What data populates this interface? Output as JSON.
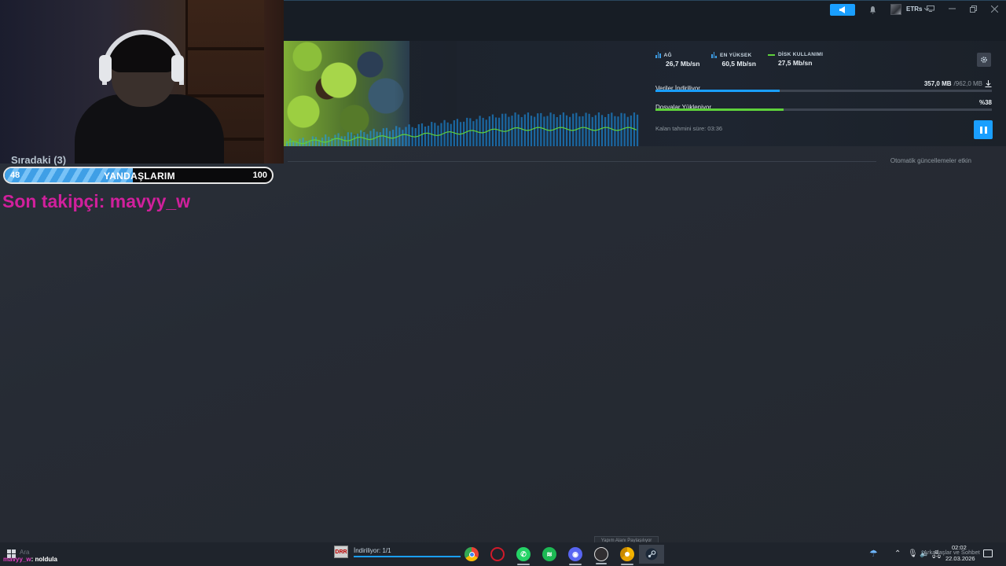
{
  "topbar": {
    "username": "ETRs",
    "icons": [
      "megaphone-icon",
      "bell-icon",
      "avatar",
      "chevron-down-icon",
      "monitor-icon",
      "minimize-icon",
      "maximize-icon",
      "close-icon"
    ],
    "accent_color": "#1a9fff"
  },
  "download": {
    "stats": [
      {
        "label": "AĞ",
        "value": "26,7 Mb/sn",
        "icon": "network-bars-icon"
      },
      {
        "label": "EN YÜKSEK",
        "value": "60,5 Mb/sn",
        "icon": "peak-bars-icon"
      },
      {
        "label": "DİSK KULLANIMI",
        "value": "27,5 Mb/sn",
        "icon": "disk-line-icon"
      }
    ],
    "download_label": "Veriler İndiriliyor",
    "download_done": "357,0 MB",
    "download_total": "/962,0 MB",
    "download_progress": 0.37,
    "disk_label": "Dosyalar Yükleniyor",
    "disk_percent": "%38",
    "disk_progress": 0.38,
    "eta": "Kalan tahmini süre: 03:36",
    "colors": {
      "network": "#1a9fff",
      "disk": "#5ed13b"
    }
  },
  "queue": {
    "title": "Sıradaki (3)",
    "auto_update": "Otomatik güncellemeler etkin"
  },
  "overlay": {
    "goal_current": "48",
    "goal_title": "YANDAŞLARIM",
    "goal_target": "100",
    "goal_fraction": 0.48,
    "follower_text": "Son takipçi: mavyy_w",
    "chat_user": "mavyy_w",
    "chat_sep": ": ",
    "chat_msg": "noldula"
  },
  "taskbar": {
    "start_label": "Ara",
    "dl_app_label": "İndiriliyor: 1/1",
    "tooltip": "Yapım Alanı Paylaşılıyor",
    "chat_label": "Arkadaşlar ve Sohbet",
    "time": "02:02",
    "date": "22.03.2026",
    "apps": [
      "chrome-icon",
      "opera-icon",
      "whatsapp-icon",
      "spotify-icon",
      "discord-icon",
      "obs-icon",
      "chrome-canary-icon",
      "steam-icon"
    ]
  }
}
